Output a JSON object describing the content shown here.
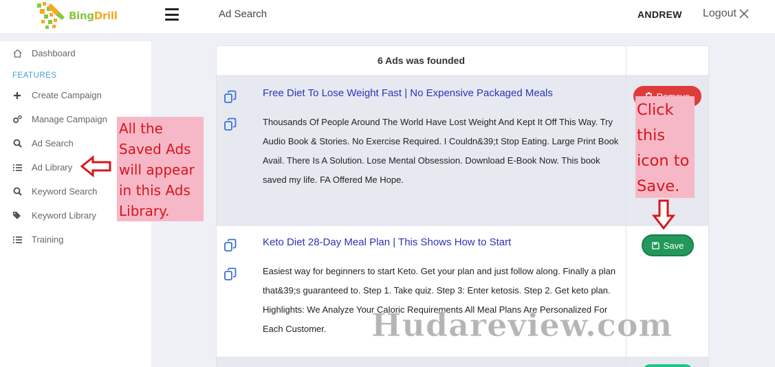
{
  "header": {
    "logo_text_a": "Bing",
    "logo_text_b": "Drill",
    "breadcrumb": "Ad Search",
    "username": "ANDREW",
    "logout_label": "Logout"
  },
  "sidebar": {
    "section_label": "FEATURES",
    "items": [
      {
        "label": "Dashboard",
        "icon": "home-icon"
      },
      {
        "label": "Create Campaign",
        "icon": "plus-icon"
      },
      {
        "label": "Manage Campaign",
        "icon": "gears-icon"
      },
      {
        "label": "Ad Search",
        "icon": "search-icon"
      },
      {
        "label": "Ad Library",
        "icon": "list-icon"
      },
      {
        "label": "Keyword Search",
        "icon": "search-icon"
      },
      {
        "label": "Keyword Library",
        "icon": "tags-icon"
      },
      {
        "label": "Training",
        "icon": "list-icon"
      }
    ]
  },
  "results": {
    "heading": "6 Ads was founded",
    "ads": [
      {
        "title": "Free Diet To Lose Weight Fast | No Expensive Packaged Meals",
        "description": "Thousands Of People Around The World Have Lost Weight And Kept It Off This Way. Try Audio Book & Stories. No Exercise Required. I Couldn&39;t Stop Eating. Large Print Book Avail. There Is A Solution. Lose Mental Obsession. Download E-Book Now. This book saved my life. FA Offered Me Hope.",
        "action_label": "Remove"
      },
      {
        "title": "Keto Diet 28-Day Meal Plan | This Shows How to Start",
        "description": "Easiest way for beginners to start Keto. Get your plan and just follow along. Finally a plan that&39;s guaranteed to. Step 1. Take quiz. Step 3: Enter ketosis. Step 2. Get keto plan. Highlights: We Analyze Your Caloric Requirements All Meal Plans Are Personalized For Each Customer.",
        "action_label": "Save"
      }
    ]
  },
  "annotations": {
    "left_note": "All the Saved Ads will appear in this Ads Library.",
    "right_note": "Click this icon to Save."
  },
  "watermark": "Hudareview.com",
  "colors": {
    "brand_green": "#8cc63f",
    "brand_orange": "#f7a823",
    "link_blue": "#2a34b8",
    "remove_red": "#e03b3b",
    "save_green": "#22995a",
    "annotation_red": "#d9141c",
    "annotation_bg": "#f6b8c6"
  }
}
